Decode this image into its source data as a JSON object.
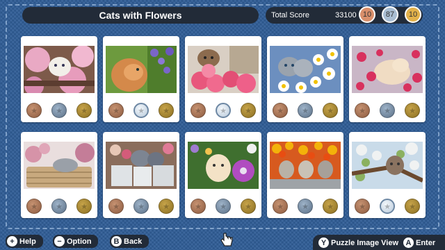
{
  "header": {
    "title": "Cats with Flowers",
    "score_label": "Total Score",
    "score_value": "33100",
    "medals": [
      {
        "type": "bronze",
        "count": "10",
        "color": "#d98f6b"
      },
      {
        "type": "silver",
        "count": "87",
        "color": "#a9bed3"
      },
      {
        "type": "gold",
        "count": "10",
        "color": "#e2b14a"
      }
    ]
  },
  "puzzles": [
    {
      "id": 1,
      "scene": "kitten-pink-blossoms",
      "silver_lit": false
    },
    {
      "id": 2,
      "scene": "cat-purple-flowers",
      "silver_lit": true
    },
    {
      "id": 3,
      "scene": "kitten-rose-basket",
      "silver_lit": true
    },
    {
      "id": 4,
      "scene": "grey-kittens-daisies",
      "silver_lit": false
    },
    {
      "id": 5,
      "scene": "kitten-pink-roses",
      "silver_lit": false
    },
    {
      "id": 6,
      "scene": "kitten-hydrangea-basket",
      "silver_lit": false
    },
    {
      "id": 7,
      "scene": "kittens-flower-pots",
      "silver_lit": false
    },
    {
      "id": 8,
      "scene": "kitten-purple-clematis",
      "silver_lit": false
    },
    {
      "id": 9,
      "scene": "three-kittens-wall",
      "silver_lit": false
    },
    {
      "id": 10,
      "scene": "kitten-in-tree",
      "silver_lit": true
    }
  ],
  "footer": {
    "help": {
      "key": "+",
      "label": "Help"
    },
    "option": {
      "key": "−",
      "label": "Option"
    },
    "back": {
      "key": "B",
      "label": "Back"
    },
    "view": {
      "key": "Y",
      "label": "Puzzle Image View"
    },
    "enter": {
      "key": "A",
      "label": "Enter"
    }
  }
}
